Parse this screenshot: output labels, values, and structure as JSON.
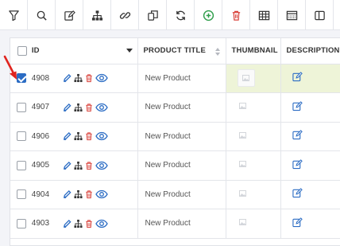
{
  "toolbar": {
    "buttons": [
      "filter-icon",
      "search-icon",
      "edit-icon",
      "hierarchy-icon",
      "link-icon",
      "duplicate-icon",
      "refresh-icon",
      "add-circle-icon",
      "trash-icon",
      "grid-table-icon",
      "dotted-grid-icon",
      "columns-icon"
    ],
    "colors": {
      "add": "#2e9d4a",
      "delete": "#d9413a",
      "default": "#333333"
    }
  },
  "table": {
    "columns": [
      "ID",
      "PRODUCT TITLE",
      "THUMBNAIL",
      "DESCRIPTION"
    ],
    "rows": [
      {
        "id": "4908",
        "title": "New Product",
        "checked": true
      },
      {
        "id": "4907",
        "title": "New Product",
        "checked": false
      },
      {
        "id": "4906",
        "title": "New Product",
        "checked": false
      },
      {
        "id": "4905",
        "title": "New Product",
        "checked": false
      },
      {
        "id": "4904",
        "title": "New Product",
        "checked": false
      },
      {
        "id": "4903",
        "title": "New Product",
        "checked": false
      }
    ]
  },
  "colors": {
    "accent": "#2b6cc4",
    "selected_row": "#eef4d8",
    "arrow": "#e0241f",
    "action_blue": "#2b6cc4",
    "action_red": "#d9413a"
  }
}
